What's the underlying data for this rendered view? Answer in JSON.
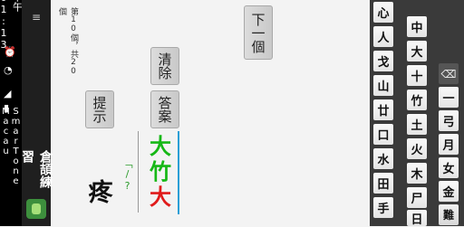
{
  "status_bar": {
    "time": "下午01:13",
    "carrier": "SmarTone Macau"
  },
  "app": {
    "title": "倉頡練習"
  },
  "quiz": {
    "progress": "第10個，共20個",
    "question_char": "疼",
    "answer_hint": "「/?",
    "answer_chars": [
      "大",
      "竹",
      "大"
    ],
    "answer_colors": [
      "#16b816",
      "#16b816",
      "#e01b1b"
    ]
  },
  "buttons": {
    "next": "下一個",
    "clear": "清除",
    "hint": "提示",
    "answer": "答案"
  },
  "keyboard": {
    "col1": [
      "心",
      "人",
      "戈",
      "山",
      "廿",
      "口",
      "水",
      "田",
      "手"
    ],
    "col2": [
      "中",
      "大",
      "十",
      "竹",
      "土",
      "火",
      "木",
      "尸",
      "日"
    ],
    "col3": [
      "⌫",
      "一",
      "弓",
      "月",
      "女",
      "金",
      "難"
    ]
  }
}
